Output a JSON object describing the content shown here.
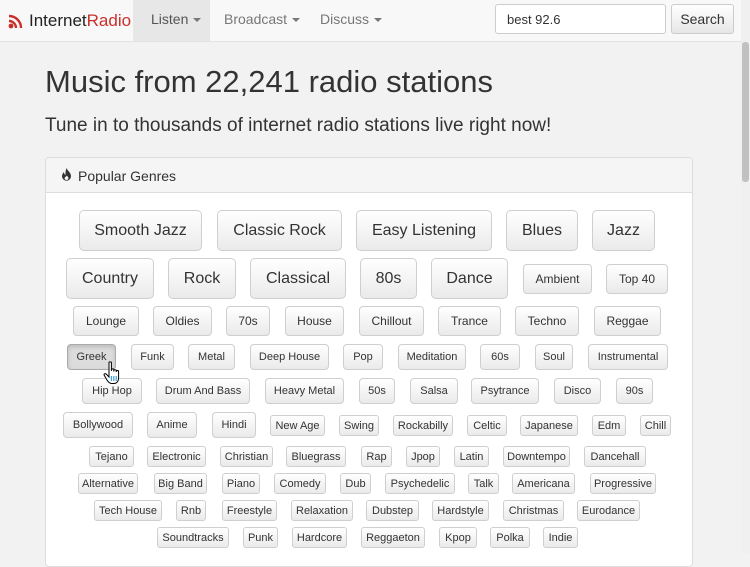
{
  "brand": {
    "part1": "Internet",
    "part2": "Radio"
  },
  "nav": {
    "listen": "Listen",
    "broadcast": "Broadcast",
    "discuss": "Discuss"
  },
  "search": {
    "value": "best 92.6",
    "button": "Search"
  },
  "hero": {
    "title": "Music from 22,241 radio stations",
    "subtitle": "Tune in to thousands of internet radio stations live right now!"
  },
  "panel": {
    "heading": "Popular Genres"
  },
  "genres": {
    "row1": [
      "Smooth Jazz",
      "Classic Rock",
      "Easy Listening",
      "Blues",
      "Jazz"
    ],
    "row2": [
      "Country",
      "Rock",
      "Classical",
      "80s",
      "Dance",
      "Ambient",
      "Top 40"
    ],
    "row3": [
      "Lounge",
      "Oldies",
      "70s",
      "House",
      "Chillout",
      "Trance",
      "Techno",
      "Reggae"
    ],
    "row4": [
      "Greek",
      "Funk",
      "Metal",
      "Deep House",
      "Pop",
      "Meditation",
      "60s",
      "Soul",
      "Instrumental"
    ],
    "row5": [
      "Hip Hop",
      "Drum And Bass",
      "Heavy Metal",
      "50s",
      "Salsa",
      "Psytrance",
      "Disco",
      "90s"
    ],
    "row6": [
      "Bollywood",
      "Anime",
      "Hindi",
      "New Age",
      "Swing",
      "Rockabilly",
      "Celtic",
      "Japanese",
      "Edm",
      "Chill"
    ],
    "row7": [
      "Tejano",
      "Electronic",
      "Christian",
      "Bluegrass",
      "Rap",
      "Jpop",
      "Latin",
      "Downtempo",
      "Dancehall"
    ],
    "row8": [
      "Alternative",
      "Big Band",
      "Piano",
      "Comedy",
      "Dub",
      "Psychedelic",
      "Talk",
      "Americana",
      "Progressive"
    ],
    "row9": [
      "Tech House",
      "Rnb",
      "Freestyle",
      "Relaxation",
      "Dubstep",
      "Hardstyle",
      "Christmas",
      "Eurodance"
    ],
    "row10": [
      "Soundtracks",
      "Punk",
      "Hardcore",
      "Reggaeton",
      "Kpop",
      "Polka",
      "Indie"
    ]
  },
  "colors": {
    "brand_red": "#c9302c",
    "navbar_bg": "#f8f8f8",
    "page_bg": "#f2f2f2"
  },
  "icons": {
    "logo": "radio-waves-icon",
    "panel": "fire-icon",
    "pointer": "hand-pointer-icon"
  }
}
